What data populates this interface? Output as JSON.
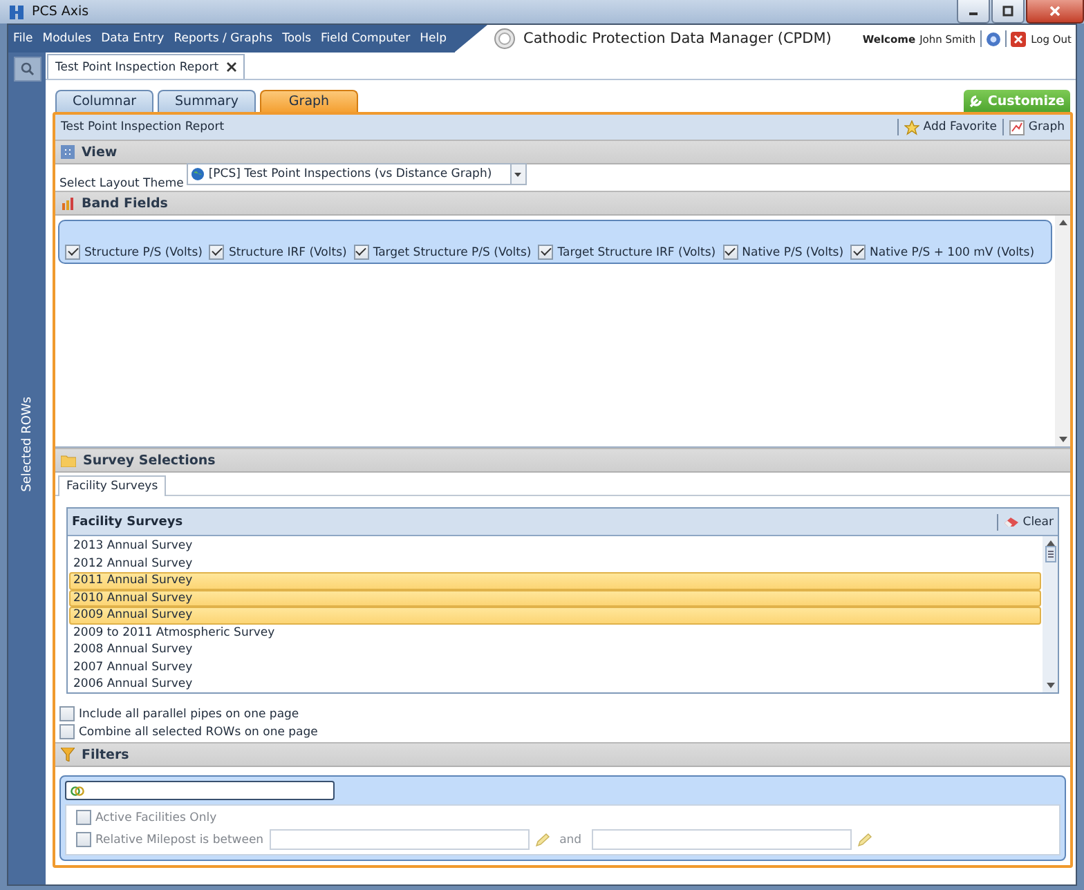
{
  "window": {
    "title": "PCS Axis"
  },
  "menu": [
    "File",
    "Modules",
    "Data Entry",
    "Reports / Graphs",
    "Tools",
    "Field Computer",
    "Help"
  ],
  "app_title": "Cathodic Protection Data Manager (CPDM)",
  "user": {
    "welcome": "Welcome",
    "name": "John Smith",
    "logout": "Log Out"
  },
  "sidebar": {
    "label": "Selected ROWs"
  },
  "document_tabs": [
    {
      "label": "Test Point Inspection Report",
      "selected": true
    }
  ],
  "view_tabs": [
    {
      "label": "Columnar",
      "selected": false
    },
    {
      "label": "Summary",
      "selected": false
    },
    {
      "label": "Graph",
      "selected": true
    }
  ],
  "customize_button": "Customize",
  "report": {
    "title": "Test Point Inspection Report",
    "actions": [
      "Add Favorite",
      "Graph"
    ]
  },
  "view": {
    "heading": "View",
    "layout_label": "Select Layout Theme",
    "layout_value": "[PCS] Test Point Inspections (vs Distance Graph)"
  },
  "band_fields": {
    "heading": "Band Fields",
    "fields": [
      {
        "label": "Structure P/S (Volts)",
        "checked": true
      },
      {
        "label": "Structure IRF (Volts)",
        "checked": true
      },
      {
        "label": "Target Structure P/S (Volts)",
        "checked": true
      },
      {
        "label": "Target Structure IRF (Volts)",
        "checked": true
      },
      {
        "label": "Native P/S (Volts)",
        "checked": true
      },
      {
        "label": "Native P/S + 100 mV (Volts)",
        "checked": true
      }
    ]
  },
  "survey_selections": {
    "heading": "Survey Selections",
    "tabs": [
      {
        "label": "Facility Surveys",
        "selected": true
      }
    ],
    "list": {
      "heading": "Facility Surveys",
      "clear": "Clear",
      "items": [
        {
          "label": "2013 Annual Survey",
          "selected": false
        },
        {
          "label": "2012 Annual Survey",
          "selected": false
        },
        {
          "label": "2011 Annual Survey",
          "selected": true
        },
        {
          "label": "2010 Annual Survey",
          "selected": true
        },
        {
          "label": "2009 Annual Survey",
          "selected": true
        },
        {
          "label": "2009 to 2011 Atmospheric Survey",
          "selected": false
        },
        {
          "label": "2008 Annual Survey",
          "selected": false
        },
        {
          "label": "2007 Annual Survey",
          "selected": false
        },
        {
          "label": "2006 Annual Survey",
          "selected": false
        }
      ]
    }
  },
  "options": [
    {
      "label": "Include all parallel pipes on one page",
      "checked": false
    },
    {
      "label": "Combine all selected ROWs on one page",
      "checked": false
    }
  ],
  "filters": {
    "heading": "Filters",
    "conditions": [
      {
        "kind": "checkbox",
        "label": "Active Facilities Only",
        "checked": false
      },
      {
        "kind": "range",
        "label": "Relative Milepost is between",
        "checked": false,
        "joiner": "and"
      }
    ]
  }
}
